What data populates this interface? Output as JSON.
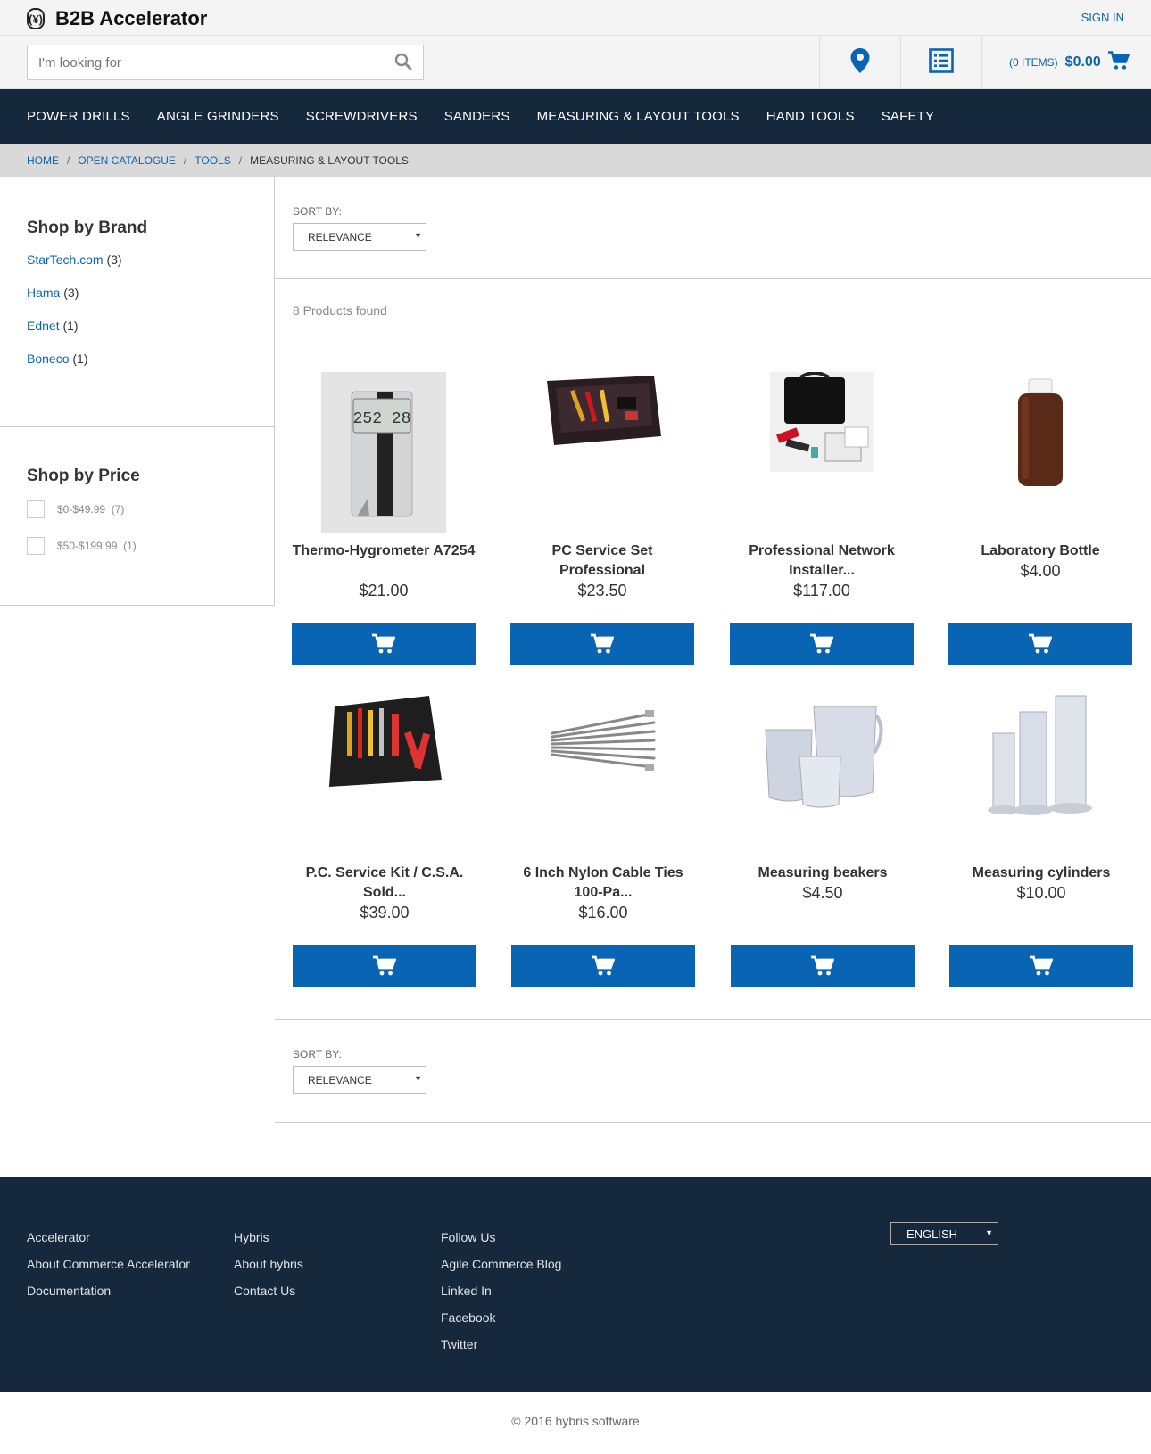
{
  "header": {
    "logo_mark": "(¥)",
    "brand": "B2B Accelerator",
    "sign_in": "SIGN IN"
  },
  "search": {
    "placeholder": "I'm looking for"
  },
  "cart": {
    "items": "(0 ITEMS)",
    "total": "$0.00"
  },
  "nav": [
    "POWER DRILLS",
    "ANGLE GRINDERS",
    "SCREWDRIVERS",
    "SANDERS",
    "MEASURING & LAYOUT TOOLS",
    "HAND TOOLS",
    "SAFETY"
  ],
  "breadcrumb": {
    "home": "HOME",
    "catalogue": "OPEN CATALOGUE",
    "tools": "TOOLS",
    "current": "MEASURING & LAYOUT TOOLS",
    "sep": "/"
  },
  "facets": {
    "brand_title": "Shop by Brand",
    "brands": [
      {
        "name": "StarTech.com",
        "count": "(3)"
      },
      {
        "name": "Hama",
        "count": "(3)"
      },
      {
        "name": "Ednet",
        "count": "(1)"
      },
      {
        "name": "Boneco",
        "count": "(1)"
      }
    ],
    "price_title": "Shop by Price",
    "prices": [
      {
        "range": "$0-$49.99",
        "count": "(7)"
      },
      {
        "range": "$50-$199.99",
        "count": "(1)"
      }
    ]
  },
  "sort": {
    "label": "SORT BY:",
    "value": "RELEVANCE"
  },
  "results": {
    "found": "8 Products found"
  },
  "products": [
    {
      "name": "Thermo-Hygrometer A7254",
      "price": "$21.00"
    },
    {
      "name": "PC Service Set Professional",
      "price": "$23.50"
    },
    {
      "name": "Professional Network Installer...",
      "price": "$117.00"
    },
    {
      "name": "Laboratory Bottle",
      "price": "$4.00"
    },
    {
      "name": "P.C. Service Kit / C.S.A. Sold...",
      "price": "$39.00"
    },
    {
      "name": "6 Inch Nylon Cable Ties 100-Pa...",
      "price": "$16.00"
    },
    {
      "name": "Measuring beakers",
      "price": "$4.50"
    },
    {
      "name": "Measuring cylinders",
      "price": "$10.00"
    }
  ],
  "footer": {
    "col1": [
      "Accelerator",
      "About Commerce Accelerator",
      "Documentation"
    ],
    "col2": [
      "Hybris",
      "About hybris",
      "Contact Us"
    ],
    "col3": [
      "Follow Us",
      "Agile Commerce Blog",
      "Linked In",
      "Facebook",
      "Twitter"
    ],
    "language": "ENGLISH",
    "copyright": "© 2016 hybris software"
  },
  "colors": {
    "accent": "#0a64b4",
    "nav_bg": "#16283b"
  }
}
